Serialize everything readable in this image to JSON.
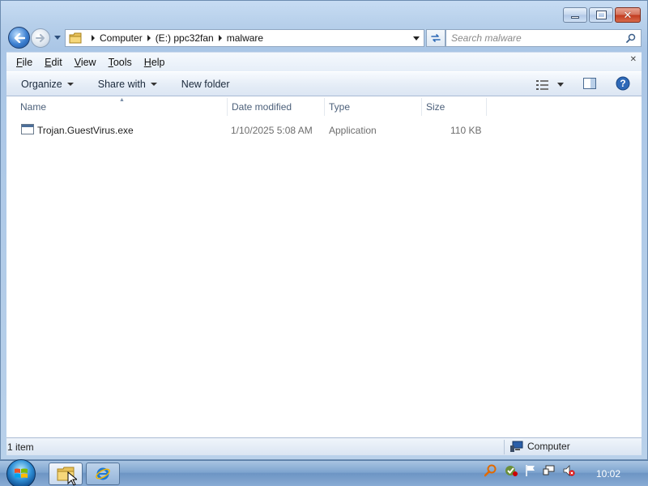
{
  "window": {
    "caption": {
      "minimize_icon": "minimize-icon",
      "maximize_icon": "maximize-icon",
      "close_icon": "close-icon",
      "close_glyph": "✕"
    }
  },
  "navbar": {
    "crumbs": [
      "Computer",
      "(E:) ppc32fan",
      "malware"
    ],
    "search_placeholder": "Search malware"
  },
  "menubar": {
    "items": [
      {
        "accel": "F",
        "rest": "ile"
      },
      {
        "accel": "E",
        "rest": "dit"
      },
      {
        "accel": "V",
        "rest": "iew"
      },
      {
        "accel": "T",
        "rest": "ools"
      },
      {
        "accel": "H",
        "rest": "elp"
      }
    ]
  },
  "cmdbar": {
    "organize": "Organize",
    "share_with": "Share with",
    "new_folder": "New folder"
  },
  "columns": {
    "name": "Name",
    "date_modified": "Date modified",
    "type": "Type",
    "size": "Size"
  },
  "files": [
    {
      "name": "Trojan.GuestVirus.exe",
      "date_modified": "1/10/2025 5:08 AM",
      "type": "Application",
      "size": "110 KB"
    }
  ],
  "statusbar": {
    "item_count": "1 item",
    "location": "Computer"
  },
  "taskbar": {
    "clock": "10:02"
  },
  "colors": {
    "accent": "#2f6bb7",
    "frame": "#b9d1ea",
    "close_red": "#c23a1e"
  }
}
